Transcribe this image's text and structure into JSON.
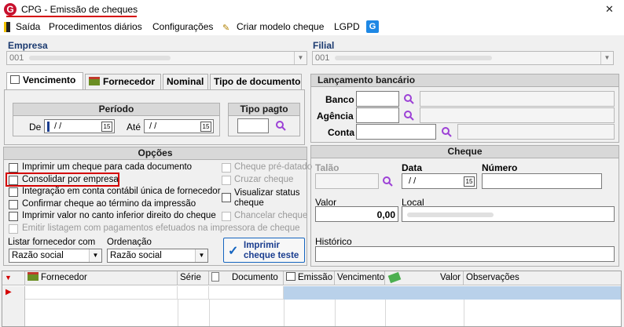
{
  "window": {
    "title": "CPG - Emissão de cheques",
    "app_icon": "G",
    "close_glyph": "✕"
  },
  "menu": {
    "saida": "Saída",
    "procedimentos": "Procedimentos diários",
    "configuracoes": "Configurações",
    "criar_modelo": "Criar modelo cheque",
    "lgpd": "LGPD"
  },
  "empresa": {
    "label": "Empresa",
    "value": "001"
  },
  "filial": {
    "label": "Filial",
    "value": "001"
  },
  "tabs": {
    "vencimento": "Vencimento",
    "fornecedor": "Fornecedor",
    "nominal": "Nominal",
    "tipo_documento": "Tipo de documento"
  },
  "periodo": {
    "title": "Período",
    "de_label": "De",
    "de_value": "/ /",
    "ate_label": "Até",
    "ate_value": "/ /"
  },
  "tipo_pagto": {
    "title": "Tipo pagto"
  },
  "lancamento": {
    "title": "Lançamento bancário",
    "banco": "Banco",
    "agencia": "Agência",
    "conta": "Conta"
  },
  "opcoes": {
    "title": "Opções",
    "imprimir_cada": "Imprimir um cheque para cada documento",
    "consolidar": "Consolidar por empresa",
    "integracao": "Integração em conta contábil única de fornecedor",
    "confirmar": "Confirmar cheque ao término da impressão",
    "imprimir_canto": "Imprimir valor no canto inferior direito do cheque",
    "emitir_listagem": "Emitir listagem com pagamentos efetuados na impressora de cheque",
    "cheque_pre": "Cheque pré-datado",
    "cruzar": "Cruzar cheque",
    "visualizar_1": "Visualizar status",
    "visualizar_2": "cheque",
    "chancelar": "Chancelar cheque",
    "listar_label": "Listar fornecedor com",
    "listar_value": "Razão social",
    "ordenacao_label": "Ordenação",
    "ordenacao_value": "Razão social",
    "imprimir_btn_1": "Imprimir",
    "imprimir_btn_2": "cheque teste"
  },
  "cheque": {
    "title": "Cheque",
    "talao": "Talão",
    "data_label": "Data",
    "data_value": "/ /",
    "numero": "Número",
    "valor_label": "Valor",
    "valor_value": "0,00",
    "local": "Local",
    "historico": "Histórico"
  },
  "grid": {
    "columns": [
      "Fornecedor",
      "Série",
      "Documento",
      "Emissão",
      "Vencimento",
      "Valor",
      "Observações"
    ]
  },
  "colors": {
    "highlight_box": "#d40000",
    "selected_row": "#b9d1ea",
    "accent": "#1565c0",
    "lens": "#9c40d6"
  }
}
